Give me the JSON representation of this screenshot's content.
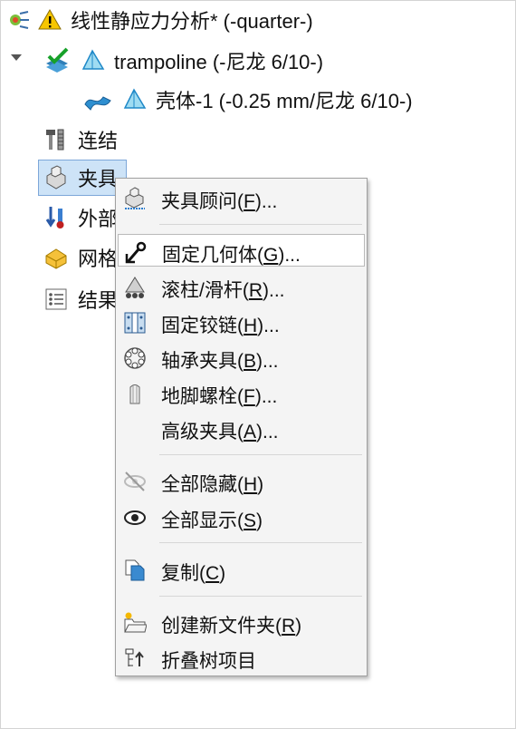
{
  "tree": {
    "study": {
      "label": "线性静应力分析* (-quarter-)"
    },
    "part": {
      "label": "trampoline (-尼龙 6/10-)"
    },
    "shell": {
      "label": "壳体-1 (-0.25 mm/尼龙 6/10-)"
    },
    "items": [
      {
        "label": "连结",
        "icon": "connections-icon"
      },
      {
        "label": "夹具",
        "icon": "fixtures-icon"
      },
      {
        "label": "外部",
        "icon": "external-loads-icon"
      },
      {
        "label": "网格",
        "icon": "mesh-icon"
      },
      {
        "label": "结果",
        "icon": "results-icon"
      }
    ]
  },
  "menu": {
    "items": [
      {
        "pre": "夹具顾问(",
        "key": "F",
        "post": ")...",
        "icon": "fixture-advisor-icon"
      },
      {
        "pre": "固定几何体(",
        "key": "G",
        "post": ")...",
        "icon": "fixed-geometry-icon"
      },
      {
        "pre": "滚柱/滑杆(",
        "key": "R",
        "post": ")...",
        "icon": "roller-slider-icon"
      },
      {
        "pre": "固定铰链(",
        "key": "H",
        "post": ")...",
        "icon": "fixed-hinge-icon"
      },
      {
        "pre": "轴承夹具(",
        "key": "B",
        "post": ")...",
        "icon": "bearing-fixture-icon"
      },
      {
        "pre": "地脚螺栓(",
        "key": "F",
        "post": ")...",
        "icon": "foundation-bolt-icon"
      },
      {
        "pre": "高级夹具(",
        "key": "A",
        "post": ")...",
        "icon": ""
      },
      {
        "pre": "全部隐藏(",
        "key": "H",
        "post": ")",
        "icon": "hide-all-icon"
      },
      {
        "pre": "全部显示(",
        "key": "S",
        "post": ")",
        "icon": "show-all-icon"
      },
      {
        "pre": "复制(",
        "key": "C",
        "post": ")",
        "icon": "copy-icon"
      },
      {
        "pre": "创建新文件夹(",
        "key": "R",
        "post": ")",
        "icon": "new-folder-icon"
      },
      {
        "pre": "折叠树项目",
        "key": "",
        "post": "",
        "icon": "collapse-tree-icon"
      }
    ]
  },
  "colors": {
    "selection": "#cde3f7",
    "selection_border": "#7da7d9",
    "menu_bg": "#f4f4f4",
    "accent_blue": "#1e88c8"
  }
}
